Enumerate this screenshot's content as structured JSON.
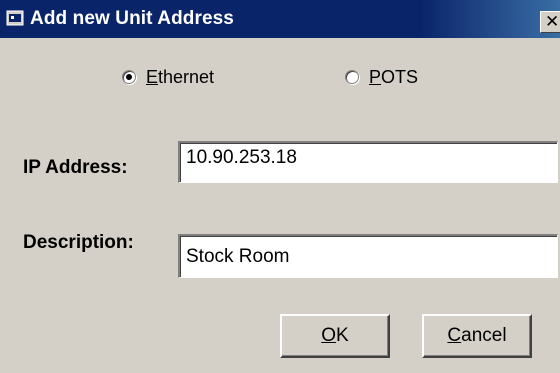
{
  "window": {
    "title": "Add new Unit Address",
    "close_glyph": "✕",
    "icon": "dialog-app-icon"
  },
  "connection": {
    "options": [
      {
        "mnemonic": "E",
        "rest": "thernet",
        "label": "Ethernet",
        "checked": true
      },
      {
        "mnemonic": "P",
        "rest": "OTS",
        "label": "POTS",
        "checked": false
      }
    ]
  },
  "fields": {
    "ip_label": "IP Address:",
    "ip_value": "10.90.253.18",
    "description_label": "Description:",
    "description_value": "Stock Room"
  },
  "buttons": {
    "ok": {
      "mnemonic": "O",
      "rest": "K"
    },
    "cancel": {
      "mnemonic": "C",
      "rest": "ancel"
    }
  },
  "colors": {
    "face": "#d4d0c8",
    "titlebar": "#0a246a",
    "titlebar_text": "#ffffff"
  }
}
